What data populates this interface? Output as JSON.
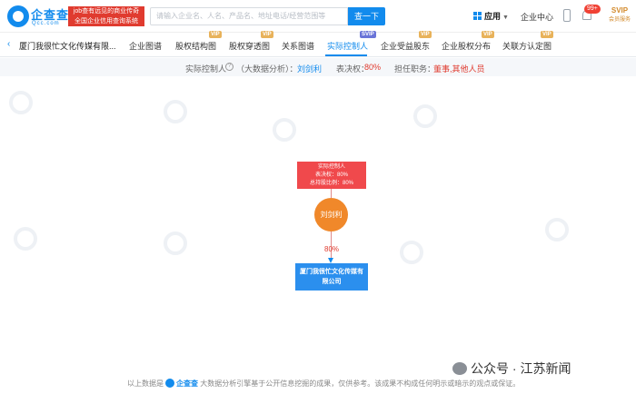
{
  "header": {
    "logo_text": "企查查",
    "logo_sub": "Qcc.com",
    "slogan_line1": "job查有远见的商业传奇",
    "slogan_line2": "全国企业信用查询系统",
    "search_placeholder": "请输入企业名、人名、产品名、地址电话/经营范围等",
    "search_button": "查一下",
    "apps_label": "应用",
    "enterprise_center": "企业中心",
    "notification_count": "99+",
    "svip_label": "SVIP",
    "svip_sub": "会员服务"
  },
  "nav": {
    "company_name": "厦门我很忙文化传媒有限...",
    "tabs": [
      "企业图谱",
      "股权结构图",
      "股权穿透图",
      "关系图谱",
      "实际控制人",
      "企业受益股东",
      "企业股权分布",
      "关联方认定图"
    ],
    "vip_tags": [
      "VIP",
      "VIP",
      "SVIP",
      "VIP",
      "VIP",
      "VIP"
    ]
  },
  "info": {
    "actual_controller_label": "实际控制人",
    "analysis_label": "（大数据分析）：",
    "controller_name": "刘剑利",
    "voting_label": "表决权：",
    "voting_value": "80%",
    "position_label": "担任职务：",
    "position_value": "董事,其他人员"
  },
  "diagram": {
    "controller_title": "实际控制人",
    "voting_line": "表决权：80%",
    "holding_line": "总持股比例：80%",
    "person_name": "刘剑利",
    "edge_percent": "80%",
    "company_line1": "厦门我很忙文化传媒有",
    "company_line2": "限公司"
  },
  "footer": {
    "prefix": "以上数据是",
    "brand": "企查查",
    "text": "大数据分析引擎基于公开信息挖掘的成果，仅供参考。该成果不构成任何明示或暗示的观点或保证。",
    "wechat": "公众号 · 江苏新闻"
  }
}
